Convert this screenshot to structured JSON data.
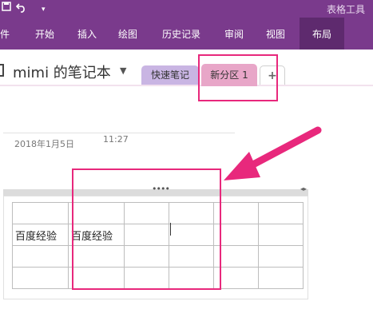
{
  "window": {
    "contextual_tab_group": "表格工具",
    "icons": [
      "save-icon",
      "undo-icon",
      "quick-access-dropdown-icon"
    ]
  },
  "ribbon": {
    "tabs": [
      "件",
      "开始",
      "插入",
      "绘图",
      "历史记录",
      "审阅",
      "视图",
      "布局"
    ],
    "active_tab": "布局"
  },
  "notebook": {
    "title": "mimi 的笔记本"
  },
  "sections": {
    "tabs": [
      "快速笔记",
      "新分区 1"
    ],
    "active": "新分区 1",
    "add_label": "+"
  },
  "page": {
    "date": "2018年1月5日",
    "time": "11:27",
    "table": {
      "grip": "••••",
      "arrows": "◂▸",
      "rows": [
        [
          "",
          "",
          "",
          "",
          "",
          ""
        ],
        [
          "百度经验",
          "百度经验",
          "",
          "",
          "",
          ""
        ],
        [
          "",
          "",
          "",
          "",
          "",
          ""
        ],
        [
          "",
          "",
          "",
          "",
          "",
          ""
        ]
      ]
    }
  },
  "colors": {
    "ribbon_purple": "#7a3a8c",
    "active_ribbon_tab": "#5e2a6e",
    "section_tab_quick": "#c9b5e3",
    "section_tab_new": "#e8a6c8",
    "annotation_magenta": "#e8287c"
  }
}
